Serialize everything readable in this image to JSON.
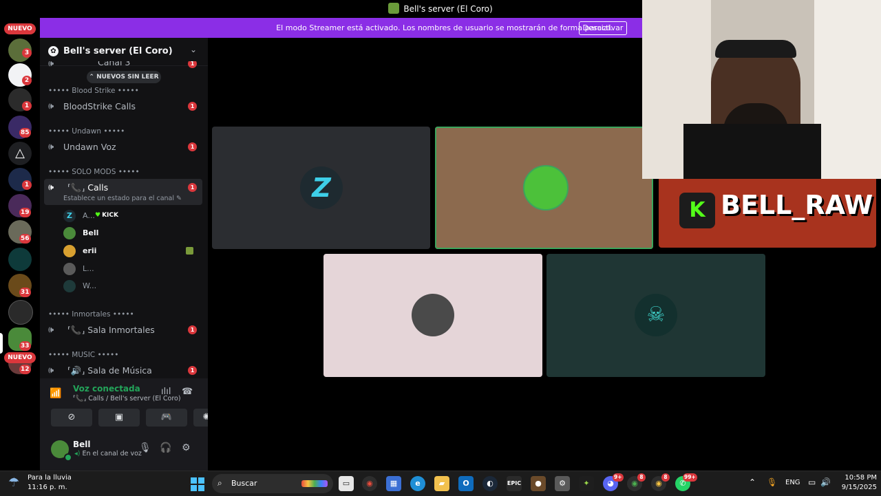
{
  "window": {
    "title": "Bell's server (El Coro)"
  },
  "banner": {
    "text": "El modo Streamer está activado. Los nombres de usuario se mostrarán de forma parcial.",
    "button": "Desactivar"
  },
  "rail": {
    "nuevo_top": "NUEVO",
    "nuevo_bottom": "NUEVO",
    "badges": [
      "3",
      "2",
      "1",
      "85",
      "1",
      "19",
      "56",
      "31",
      "33",
      "12"
    ]
  },
  "server": {
    "name": "Bell's server (El Coro)"
  },
  "sidebar": {
    "unread_pill": "NUEVOS SIN LEER",
    "partial_channel": "Canal 3",
    "categories": [
      {
        "label": "••••• Blood Strike •••••"
      },
      {
        "label": "••••• Undawn •••••"
      },
      {
        "label": "••••• SOLO MODS •••••"
      },
      {
        "label": "••••• Inmortales •••••"
      },
      {
        "label": "••••• MUSIC •••••"
      }
    ],
    "channels": [
      {
        "name": "BloodStrike Calls",
        "badge": "1"
      },
      {
        "name": "Undawn Voz",
        "badge": "1"
      },
      {
        "name": "Calls",
        "badge": "1",
        "status": "Establece un estado para el canal"
      },
      {
        "name": "Sala Inmortales",
        "badge": "1"
      },
      {
        "name": "Sala de Música",
        "badge": "1"
      }
    ],
    "members": [
      {
        "name": "A...",
        "tag": "KICK"
      },
      {
        "name": "Bell"
      },
      {
        "name": "erii"
      },
      {
        "name": "L..."
      },
      {
        "name": "W..."
      }
    ]
  },
  "voice": {
    "status": "Voz conectada",
    "channel": "Calls / Bell's server (El Coro)"
  },
  "user": {
    "name": "Bell",
    "sub": "En el canal de voz"
  },
  "kick": {
    "k": "K",
    "name": "BELL_RAW"
  },
  "taskbar": {
    "weather_line1": "Para la lluvia",
    "weather_line2": "11:16 p. m.",
    "search": "Buscar",
    "epic": "EPIC",
    "badges": [
      "9+",
      "8",
      "8",
      "99+"
    ],
    "lang": "ENG",
    "time": "10:58 PM",
    "date": "9/15/2025"
  },
  "colors": {
    "discord_red": "#da373c",
    "voice_green": "#23a55a",
    "streamer_purple": "#8b2ee6",
    "kick_green": "#53fc18",
    "speaking_border": "#3ba55c"
  }
}
